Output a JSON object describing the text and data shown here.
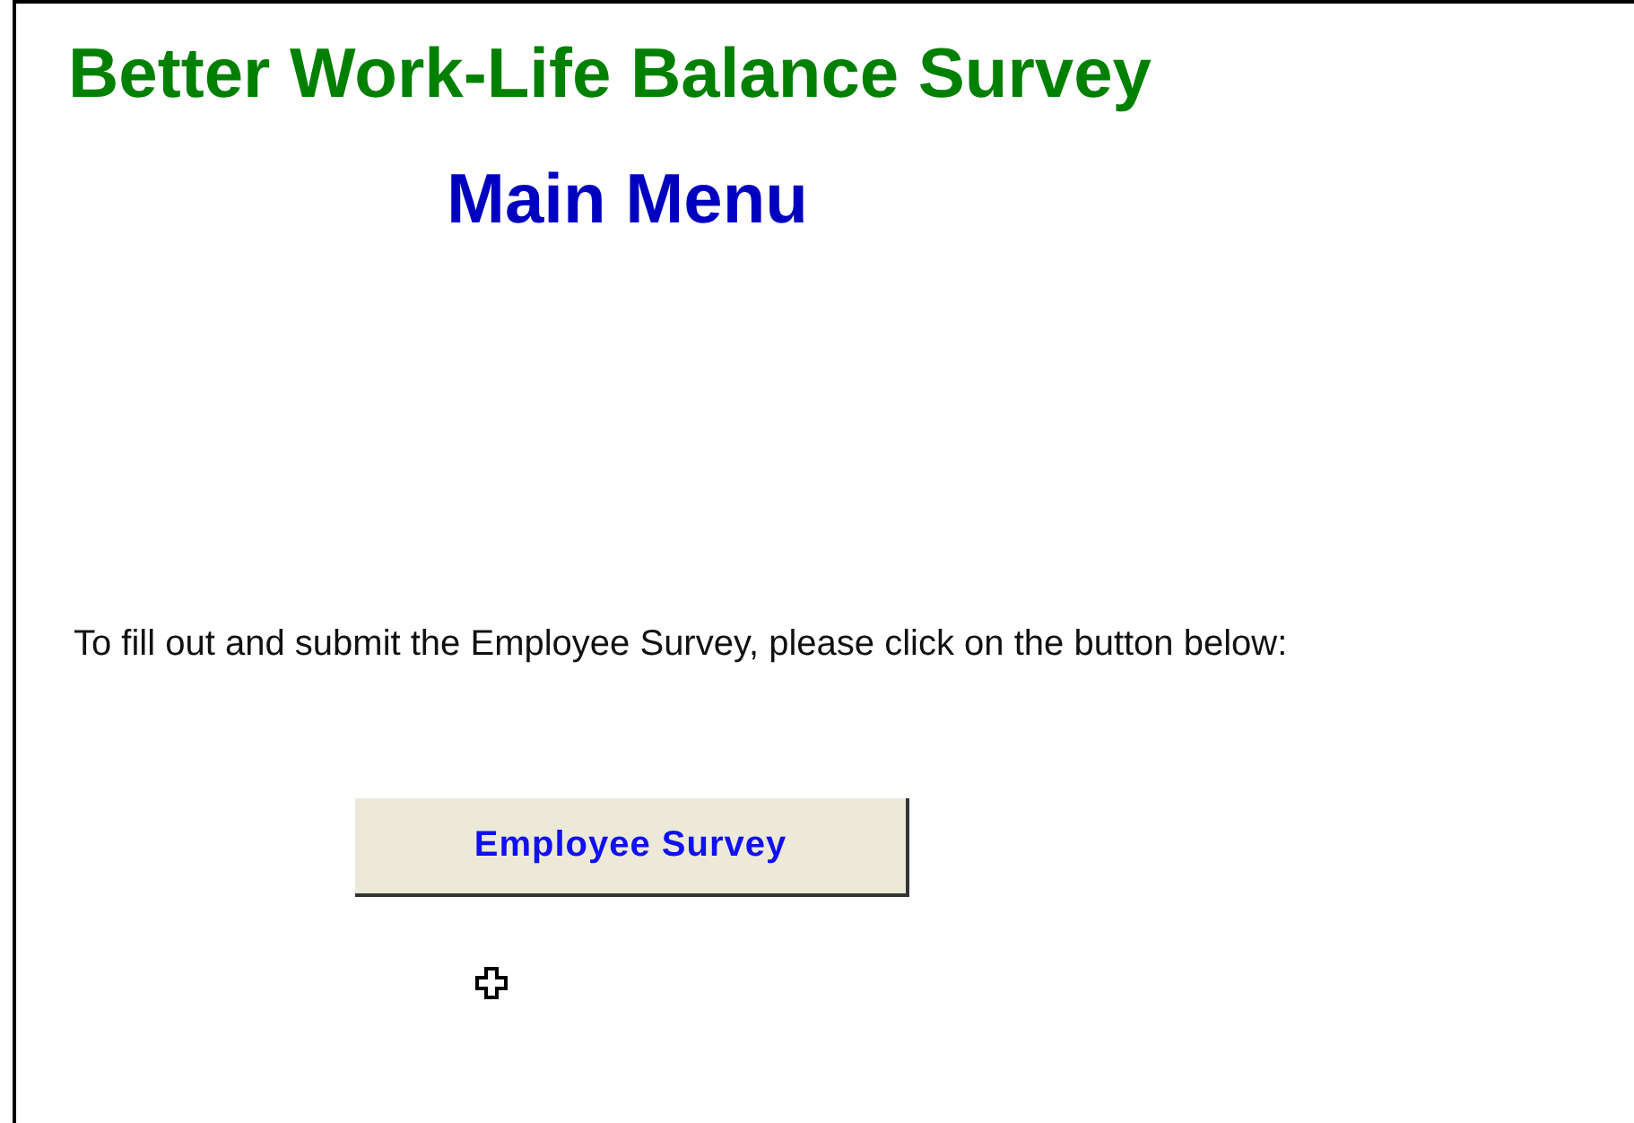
{
  "title": "Better Work-Life Balance Survey",
  "subtitle": "Main Menu",
  "instructions": "To fill out and submit the Employee Survey, please click on the button below:",
  "buttons": [
    {
      "label": "Employee Survey"
    }
  ]
}
